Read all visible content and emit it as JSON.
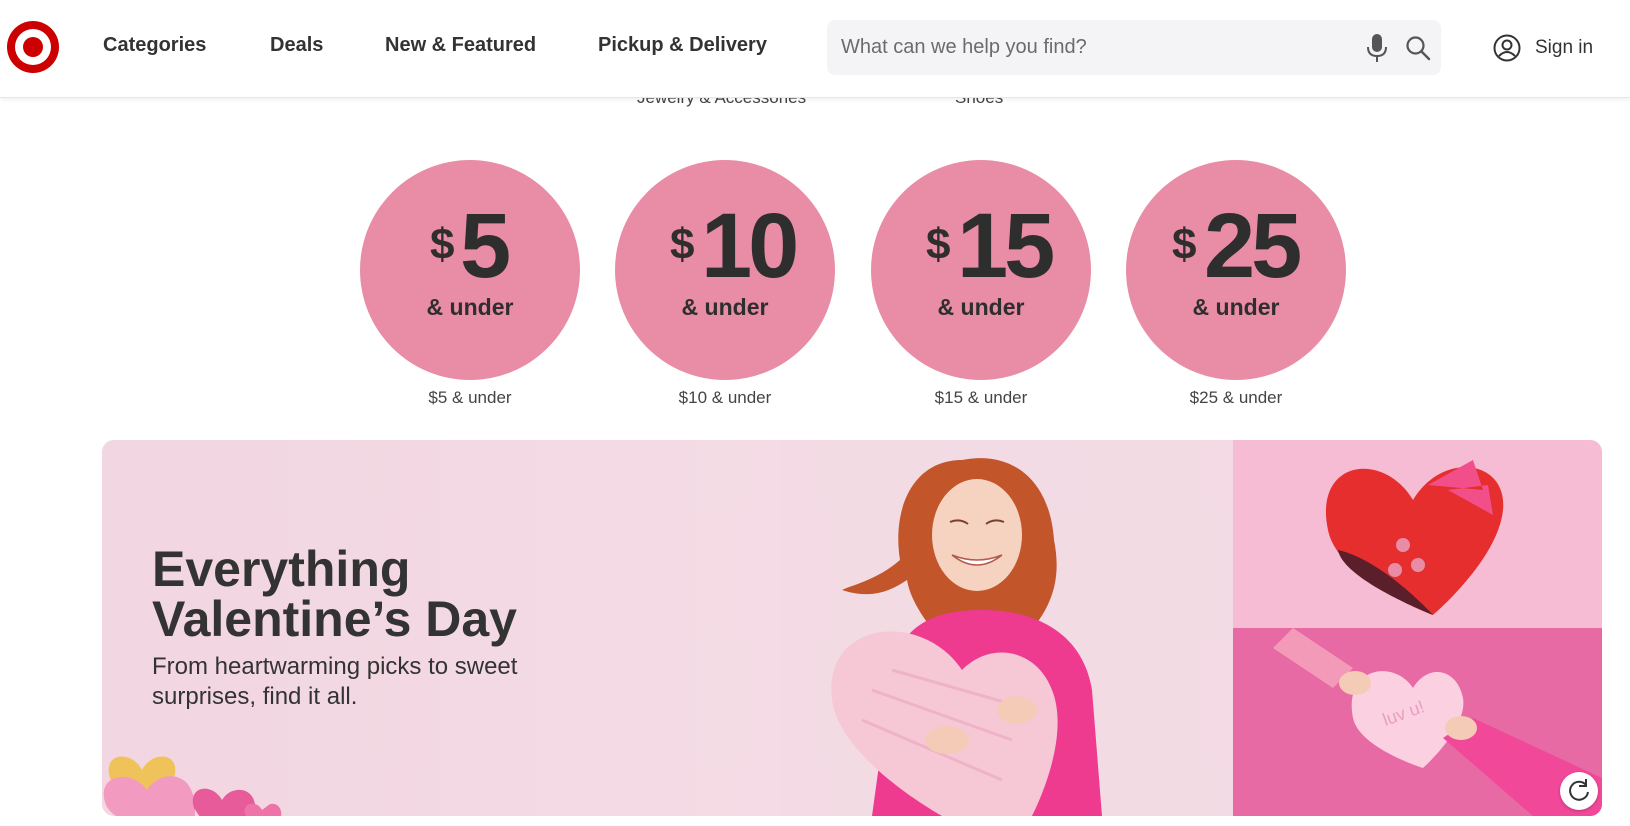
{
  "header": {
    "nav": [
      "Categories",
      "Deals",
      "New & Featured",
      "Pickup & Delivery"
    ],
    "search_placeholder": "What can we help you find?",
    "signin_label": "Sign in",
    "brand_color": "#cc0000"
  },
  "category_labels": [
    "Jewelry & Accessories",
    "Shoes"
  ],
  "price_tiles": [
    {
      "amount": "5",
      "under": "& under",
      "caption": "$5 & under"
    },
    {
      "amount": "10",
      "under": "& under",
      "caption": "$10 & under"
    },
    {
      "amount": "15",
      "under": "& under",
      "caption": "$15 & under"
    },
    {
      "amount": "25",
      "under": "& under",
      "caption": "$25 & under"
    }
  ],
  "circle_color": "#e98ca6",
  "banner": {
    "title_line1": "Everything",
    "title_line2": "Valentine’s Day",
    "subtitle": "From heartwarming picks to sweet surprises, find it all.",
    "love_note": "luv u!"
  },
  "icons": [
    "target-logo",
    "microphone-icon",
    "search-icon",
    "account-icon",
    "replay-icon"
  ]
}
